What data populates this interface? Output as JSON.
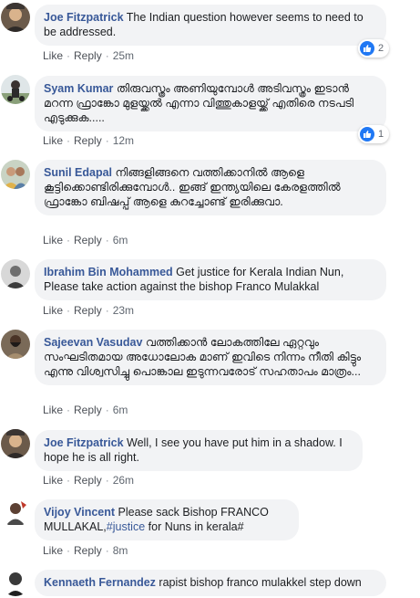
{
  "comments": [
    {
      "author": "Joe Fitzpatrick",
      "text": "The Indian question however seems to need to be addressed.",
      "like": "Like",
      "reply": "Reply",
      "time": "25m",
      "reactions": "2"
    },
    {
      "author": "Syam Kumar",
      "text": "തിരുവസ്ത്രം അണിയുമ്പോൾ അടിവസ്ത്രം ഇടാൻ മറന്ന ഫ്രാങ്കോ മുളയ്ക്കൽ എന്നാ വിത്തുകാളയ്ക്ക് എതിരെ നടപടി എടുക്കുക.....",
      "like": "Like",
      "reply": "Reply",
      "time": "12m",
      "reactions": "1"
    },
    {
      "author": "Sunil Edapal",
      "text": "നിങ്ങളിങ്ങനെ വത്തിക്കാനിൽ ആളെ കൂട്ടിക്കൊണ്ടിരിക്കുമ്പോൾ.. ഇങ്ങ് ഇന്ത്യയിലെ കേരളത്തിൽ ഫ്രാങ്കോ ബിഷപ്പ് ആളെ കുറച്ചോണ്ട് ഇരിക്കുവാ.",
      "like": "Like",
      "reply": "Reply",
      "time": "6m"
    },
    {
      "author": "Ibrahim Bin Mohammed",
      "text": "Get justice for Kerala Indian Nun, Please take action against the bishop Franco Mulakkal",
      "like": "Like",
      "reply": "Reply",
      "time": "23m"
    },
    {
      "author": "Sajeevan Vasudav",
      "text": "വത്തിക്കാൻ ലോകത്തിലേ ഏറ്റവും സംഘടിതമായ അധോലോക മാണ് ഇവിടെ നിന്നം നീതി കിട്ടും എന്നു വിശ്വസിച്ചു പൊങ്കാല ഇടുന്നവരോട് സഹതാപം മാത്രം...",
      "like": "Like",
      "reply": "Reply",
      "time": "6m"
    },
    {
      "author": "Joe Fitzpatrick",
      "text": "Well, I see you have put him in a shadow. I hope he is all right.",
      "like": "Like",
      "reply": "Reply",
      "time": "26m"
    },
    {
      "author": "Vijoy Vincent",
      "text": "Please sack Bishop FRANCO MULLAKAL,",
      "hashtag": "#justice",
      "text_after": " for Nuns in kerala#",
      "like": "Like",
      "reply": "Reply",
      "time": "8m"
    },
    {
      "author": "Kennaeth Fernandez",
      "text": "rapist bishop franco mulakkel step down"
    }
  ],
  "icons": {
    "reaction": "like-thumb-icon"
  },
  "colors": {
    "author": "#385898",
    "bubble": "#f2f3f5",
    "like_badge": "#2078f4",
    "meta": "#606770"
  }
}
